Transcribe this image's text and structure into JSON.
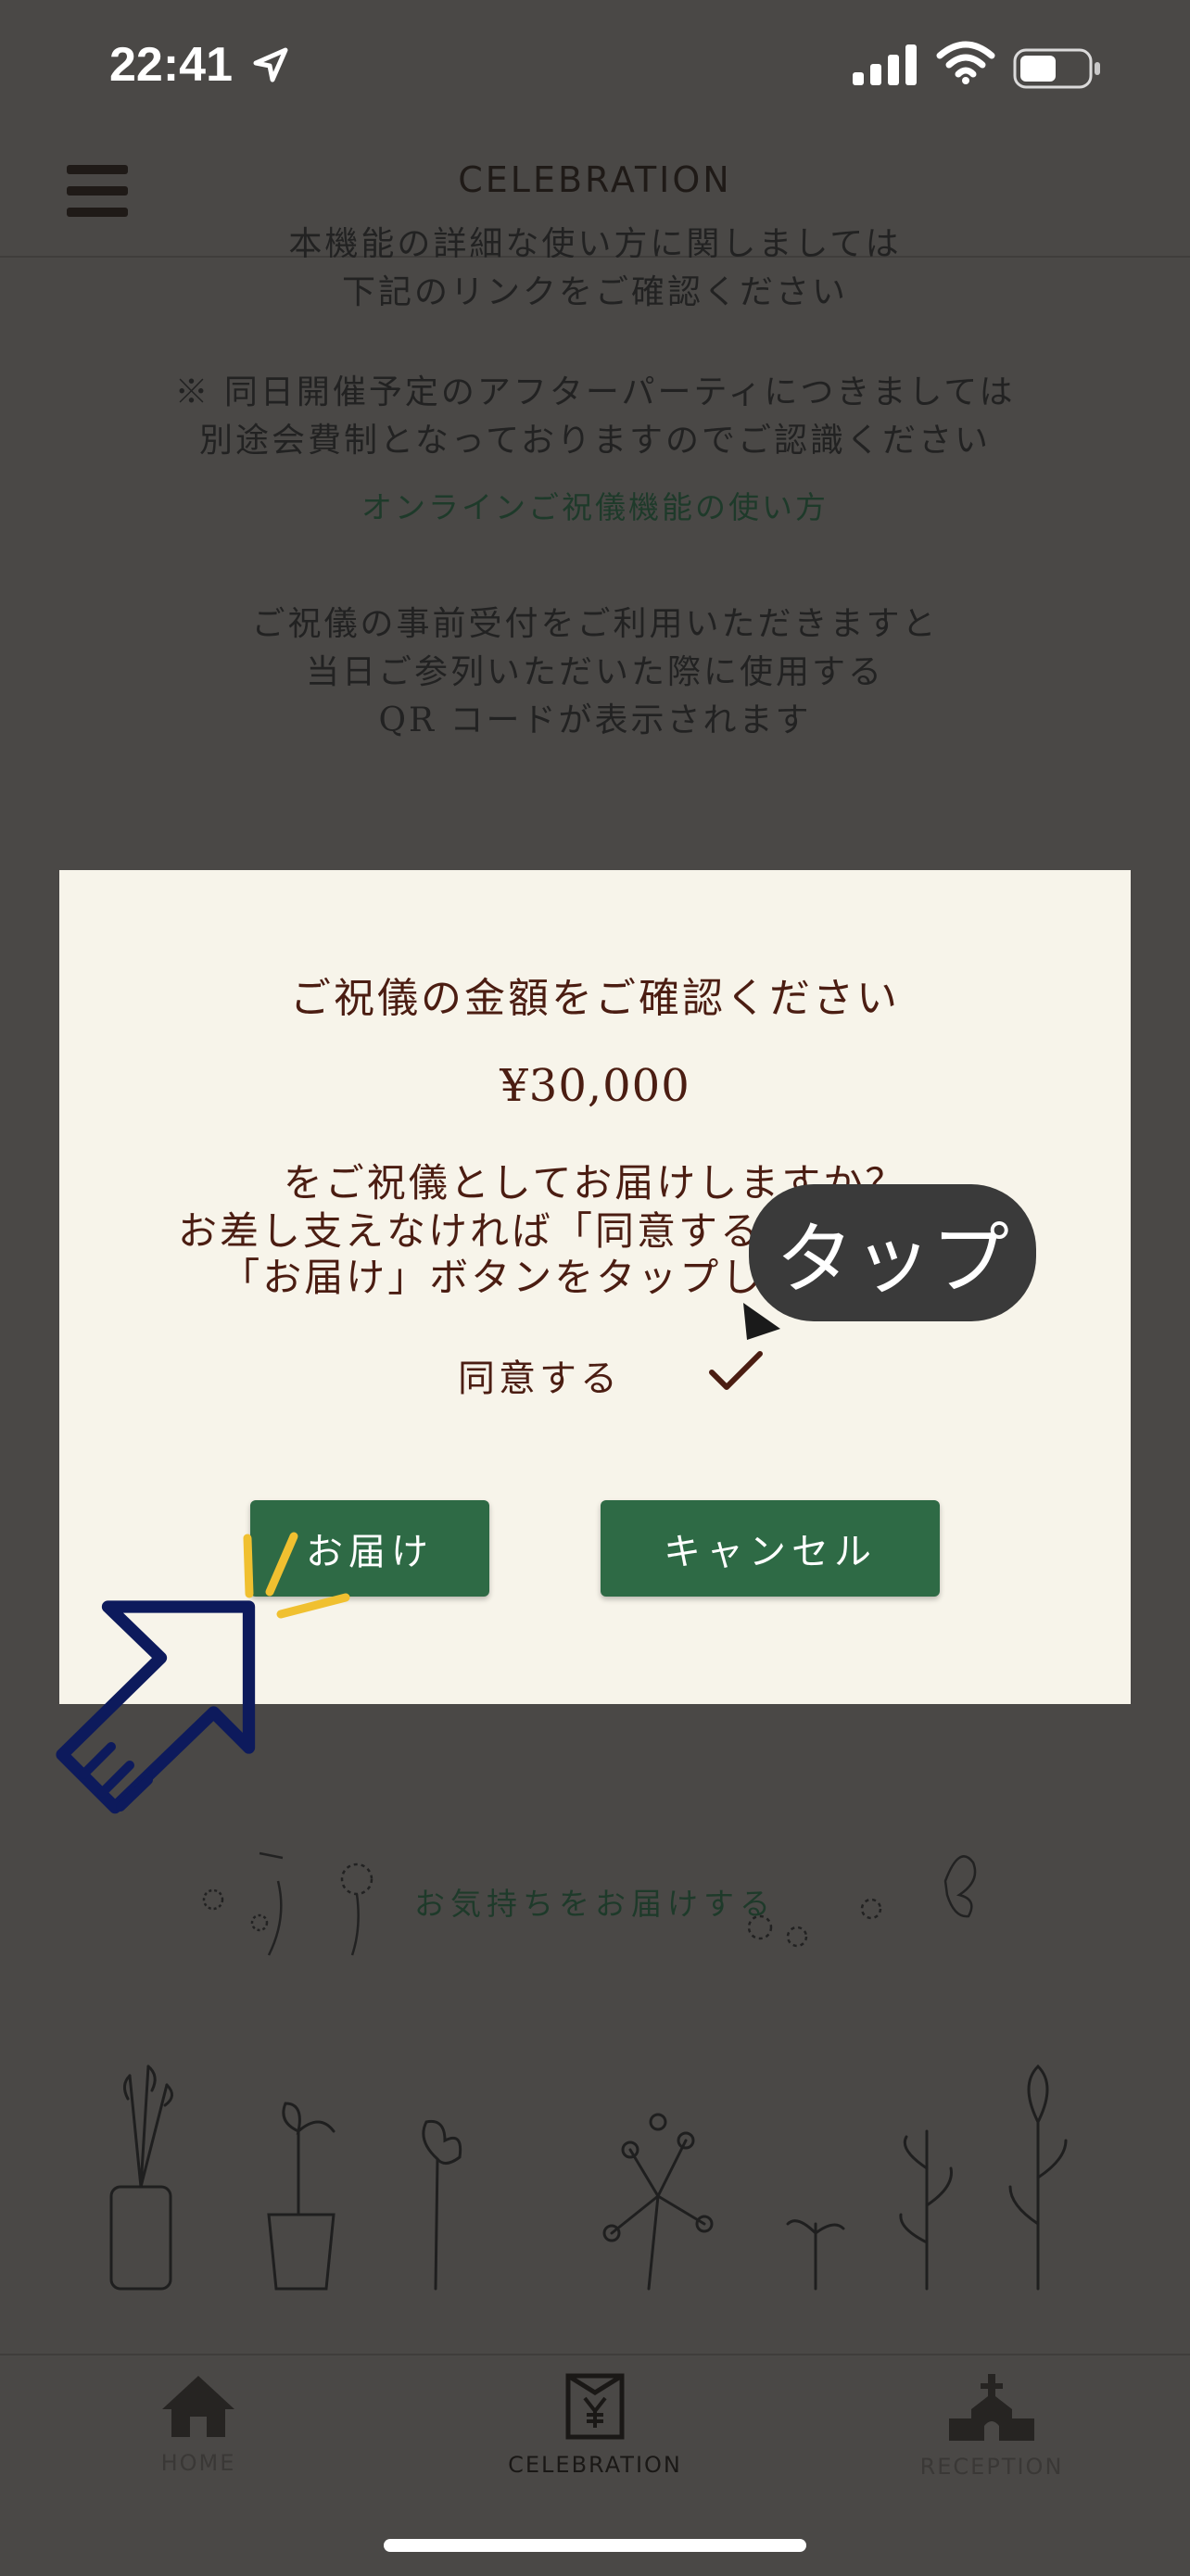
{
  "status_bar": {
    "time": "22:41"
  },
  "header": {
    "title": "CELEBRATION"
  },
  "background": {
    "line1": "本機能の詳細な使い方に関しましては",
    "line2": "下記のリンクをご確認ください",
    "note1": "※ 同日開催予定のアフターパーティにつきましては",
    "note2": "別途会費制となっておりますのでご認識ください",
    "link": "オンラインご祝儀機能の使い方",
    "info1": "ご祝儀の事前受付をご利用いただきますと",
    "info2": "当日ご参列いただいた際に使用する",
    "info3": "QR コードが表示されます"
  },
  "modal": {
    "heading": "ご祝儀の金額をご確認ください",
    "amount": "¥30,000",
    "question1": "をご祝儀としてお届けしますか？",
    "question2": "お差し支えなければ「同意する」をタップし",
    "question3": "「お届け」ボタンをタップしてください",
    "agree_label": "同意する",
    "deliver_button": "お届け",
    "cancel_button": "キャンセル"
  },
  "annotation": {
    "tap_label": "タップ"
  },
  "decoration": {
    "caption": "お気持ちをお届けする"
  },
  "tab_bar": {
    "items": [
      {
        "label": "HOME",
        "icon": "house-icon"
      },
      {
        "label": "CELEBRATION",
        "icon": "envelope-yen-icon"
      },
      {
        "label": "RECEPTION",
        "icon": "chapel-icon"
      }
    ]
  },
  "colors": {
    "accent": "#2e6a45",
    "modal_bg": "#f7f4ea",
    "text": "#4b1d12",
    "dim_bg": "#4a4846"
  }
}
